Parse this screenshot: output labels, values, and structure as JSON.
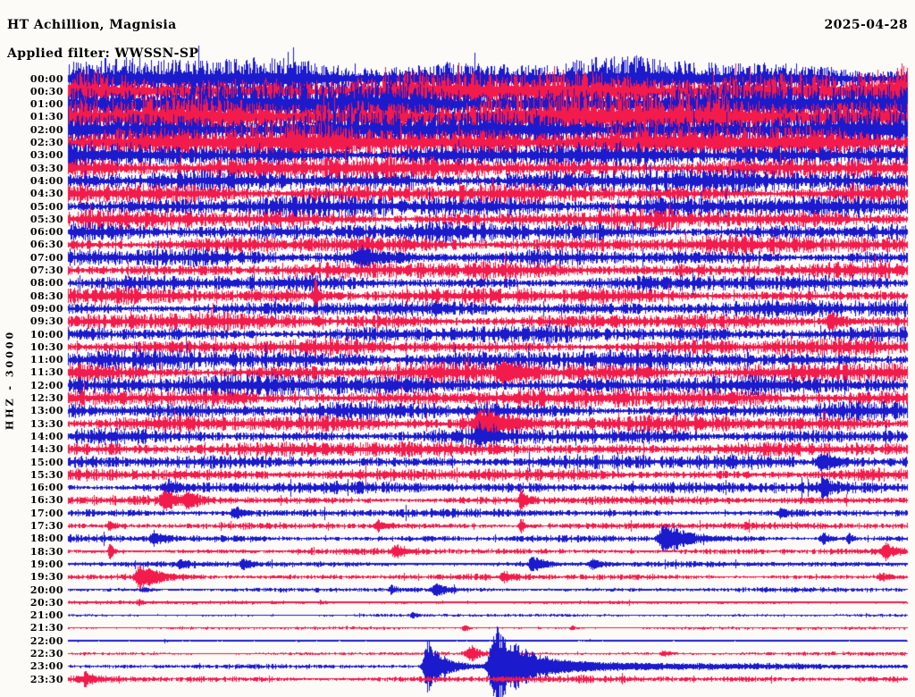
{
  "header": {
    "station_title": "HT Achillion, Magnisia",
    "filter_label": "Applied filter: WWSSN-SP",
    "date": "2025-04-28"
  },
  "axis": {
    "channel_label": "HHZ - 30000",
    "minutes_per_row": 30
  },
  "colors": {
    "blue": "#1b1acd",
    "red": "#f31b4c",
    "background": "#fcfbf8",
    "text": "#000000"
  },
  "chart_data": {
    "type": "line",
    "subtype": "helicorder-seismogram",
    "title": "HT Achillion, Magnisia",
    "date": "2025-04-28",
    "channel": "HHZ",
    "gain": "30000",
    "filter": "WWSSN-SP",
    "row_duration_minutes": 30,
    "amplitude_unit": "pixels half-amplitude (relative, estimated)",
    "event_fields": "f = fraction along row, a = peak half-amplitude px, wl = attack width px, wr = decay length px",
    "rows": [
      {
        "time": "00:00",
        "color": "blue",
        "amp": 17,
        "events": []
      },
      {
        "time": "00:30",
        "color": "red",
        "amp": 19,
        "events": []
      },
      {
        "time": "01:00",
        "color": "blue",
        "amp": 20,
        "events": []
      },
      {
        "time": "01:30",
        "color": "red",
        "amp": 20,
        "events": []
      },
      {
        "time": "02:00",
        "color": "blue",
        "amp": 18,
        "events": []
      },
      {
        "time": "02:30",
        "color": "red",
        "amp": 15,
        "events": []
      },
      {
        "time": "03:00",
        "color": "blue",
        "amp": 11,
        "events": []
      },
      {
        "time": "03:30",
        "color": "red",
        "amp": 10,
        "events": []
      },
      {
        "time": "04:00",
        "color": "blue",
        "amp": 9.5,
        "events": []
      },
      {
        "time": "04:30",
        "color": "red",
        "amp": 9,
        "events": []
      },
      {
        "time": "05:00",
        "color": "blue",
        "amp": 9,
        "events": []
      },
      {
        "time": "05:30",
        "color": "red",
        "amp": 8.5,
        "events": []
      },
      {
        "time": "06:00",
        "color": "blue",
        "amp": 8,
        "events": []
      },
      {
        "time": "06:30",
        "color": "red",
        "amp": 7.5,
        "events": []
      },
      {
        "time": "07:00",
        "color": "blue",
        "amp": 7,
        "events": [
          {
            "f": 0.35,
            "a": 9,
            "wl": 7,
            "wr": 20
          }
        ]
      },
      {
        "time": "07:30",
        "color": "red",
        "amp": 7,
        "events": []
      },
      {
        "time": "08:00",
        "color": "blue",
        "amp": 7,
        "events": []
      },
      {
        "time": "08:30",
        "color": "red",
        "amp": 7,
        "events": [
          {
            "f": 0.295,
            "a": 24,
            "wl": 1.5,
            "wr": 2.5
          }
        ]
      },
      {
        "time": "09:00",
        "color": "blue",
        "amp": 7,
        "events": []
      },
      {
        "time": "09:30",
        "color": "red",
        "amp": 7,
        "events": [
          {
            "f": 0.91,
            "a": 9,
            "wl": 4,
            "wr": 12
          }
        ]
      },
      {
        "time": "10:00",
        "color": "blue",
        "amp": 7,
        "events": []
      },
      {
        "time": "10:30",
        "color": "red",
        "amp": 7,
        "events": []
      },
      {
        "time": "11:00",
        "color": "blue",
        "amp": 8,
        "events": []
      },
      {
        "time": "11:30",
        "color": "red",
        "amp": 9,
        "events": [
          {
            "f": 0.52,
            "a": 11,
            "wl": 5,
            "wr": 18
          }
        ]
      },
      {
        "time": "12:00",
        "color": "blue",
        "amp": 9,
        "events": []
      },
      {
        "time": "12:30",
        "color": "red",
        "amp": 8,
        "events": []
      },
      {
        "time": "13:00",
        "color": "blue",
        "amp": 8,
        "events": []
      },
      {
        "time": "13:30",
        "color": "red",
        "amp": 7,
        "events": [
          {
            "f": 0.49,
            "a": 17,
            "wl": 4,
            "wr": 26
          }
        ]
      },
      {
        "time": "14:00",
        "color": "blue",
        "amp": 7,
        "events": [
          {
            "f": 0.49,
            "a": 9,
            "wl": 4,
            "wr": 16
          }
        ]
      },
      {
        "time": "14:30",
        "color": "red",
        "amp": 6.5,
        "events": []
      },
      {
        "time": "15:00",
        "color": "blue",
        "amp": 6,
        "events": [
          {
            "f": 0.9,
            "a": 10,
            "wl": 4,
            "wr": 14
          }
        ]
      },
      {
        "time": "15:30",
        "color": "red",
        "amp": 6,
        "events": []
      },
      {
        "time": "16:00",
        "color": "blue",
        "amp": 5,
        "events": [
          {
            "f": 0.12,
            "a": 6,
            "wl": 3,
            "wr": 9
          },
          {
            "f": 0.9,
            "a": 9,
            "wl": 3,
            "wr": 10
          }
        ]
      },
      {
        "time": "16:30",
        "color": "red",
        "amp": 4,
        "events": [
          {
            "f": 0.115,
            "a": 11,
            "wl": 3,
            "wr": 10
          },
          {
            "f": 0.143,
            "a": 9,
            "wl": 3,
            "wr": 9
          },
          {
            "f": 0.54,
            "a": 13,
            "wl": 2,
            "wr": 5
          }
        ]
      },
      {
        "time": "17:00",
        "color": "blue",
        "amp": 3.5,
        "events": [
          {
            "f": 0.2,
            "a": 7,
            "wl": 4,
            "wr": 10
          },
          {
            "f": 0.85,
            "a": 5,
            "wl": 3,
            "wr": 8
          }
        ]
      },
      {
        "time": "17:30",
        "color": "red",
        "amp": 3,
        "events": [
          {
            "f": 0.05,
            "a": 5,
            "wl": 2,
            "wr": 6
          },
          {
            "f": 0.37,
            "a": 6,
            "wl": 3,
            "wr": 9
          },
          {
            "f": 0.54,
            "a": 12,
            "wl": 1.5,
            "wr": 3
          }
        ]
      },
      {
        "time": "18:00",
        "color": "blue",
        "amp": 3,
        "events": [
          {
            "f": 0.103,
            "a": 7,
            "wl": 3,
            "wr": 10
          },
          {
            "f": 0.712,
            "a": 19,
            "wl": 5,
            "wr": 24
          },
          {
            "f": 0.9,
            "a": 7,
            "wl": 3,
            "wr": 9
          },
          {
            "f": 0.93,
            "a": 9,
            "wl": 1.5,
            "wr": 3
          }
        ]
      },
      {
        "time": "18:30",
        "color": "red",
        "amp": 2.5,
        "events": [
          {
            "f": 0.05,
            "a": 11,
            "wl": 1.5,
            "wr": 4
          },
          {
            "f": 0.39,
            "a": 7,
            "wl": 3,
            "wr": 10
          },
          {
            "f": 0.975,
            "a": 8,
            "wl": 4,
            "wr": 10
          }
        ]
      },
      {
        "time": "19:00",
        "color": "blue",
        "amp": 2.5,
        "events": [
          {
            "f": 0.135,
            "a": 5,
            "wl": 3,
            "wr": 8
          },
          {
            "f": 0.21,
            "a": 6,
            "wl": 3,
            "wr": 9
          },
          {
            "f": 0.555,
            "a": 9,
            "wl": 4,
            "wr": 14
          },
          {
            "f": 0.625,
            "a": 6,
            "wl": 3,
            "wr": 9
          }
        ]
      },
      {
        "time": "19:30",
        "color": "red",
        "amp": 2.5,
        "events": [
          {
            "f": 0.085,
            "a": 15,
            "wl": 3,
            "wr": 20
          },
          {
            "f": 0.52,
            "a": 5,
            "wl": 3,
            "wr": 8
          },
          {
            "f": 0.97,
            "a": 5,
            "wl": 3,
            "wr": 8
          }
        ]
      },
      {
        "time": "20:00",
        "color": "blue",
        "amp": 2,
        "events": [
          {
            "f": 0.09,
            "a": 3,
            "wl": 2,
            "wr": 6
          },
          {
            "f": 0.385,
            "a": 5,
            "wl": 2,
            "wr": 6
          },
          {
            "f": 0.44,
            "a": 7,
            "wl": 4,
            "wr": 12
          }
        ]
      },
      {
        "time": "20:30",
        "color": "red",
        "amp": 1.5,
        "events": [
          {
            "f": 0.085,
            "a": 3,
            "wl": 2,
            "wr": 6
          },
          {
            "f": 0.3,
            "a": 2,
            "wl": 2,
            "wr": 6
          }
        ]
      },
      {
        "time": "21:00",
        "color": "blue",
        "amp": 1.2,
        "events": [
          {
            "f": 0.41,
            "a": 4,
            "wl": 1.5,
            "wr": 4
          }
        ]
      },
      {
        "time": "21:30",
        "color": "red",
        "amp": 1.2,
        "events": [
          {
            "f": 0.473,
            "a": 4,
            "wl": 2,
            "wr": 5
          },
          {
            "f": 0.6,
            "a": 3,
            "wl": 2,
            "wr": 5
          }
        ]
      },
      {
        "time": "22:00",
        "color": "blue",
        "amp": 0.8,
        "events": []
      },
      {
        "time": "22:30",
        "color": "red",
        "amp": 1.5,
        "events": [
          {
            "f": 0.48,
            "a": 9,
            "wl": 4,
            "wr": 10
          },
          {
            "f": 0.71,
            "a": 4,
            "wl": 2,
            "wr": 6
          }
        ]
      },
      {
        "time": "23:00",
        "color": "blue",
        "amp": 1.8,
        "events": [
          {
            "f": 0.428,
            "a": 32,
            "wl": 3,
            "wr": 18
          },
          {
            "f": 0.508,
            "a": 46,
            "wl": 4,
            "wr": 34
          },
          {
            "f": 0.53,
            "a": 4,
            "wl": 20,
            "wr": 320
          }
        ]
      },
      {
        "time": "23:30",
        "color": "red",
        "amp": 3,
        "events": [
          {
            "f": 0.02,
            "a": 6,
            "wl": 2,
            "wr": 10
          }
        ]
      }
    ]
  }
}
